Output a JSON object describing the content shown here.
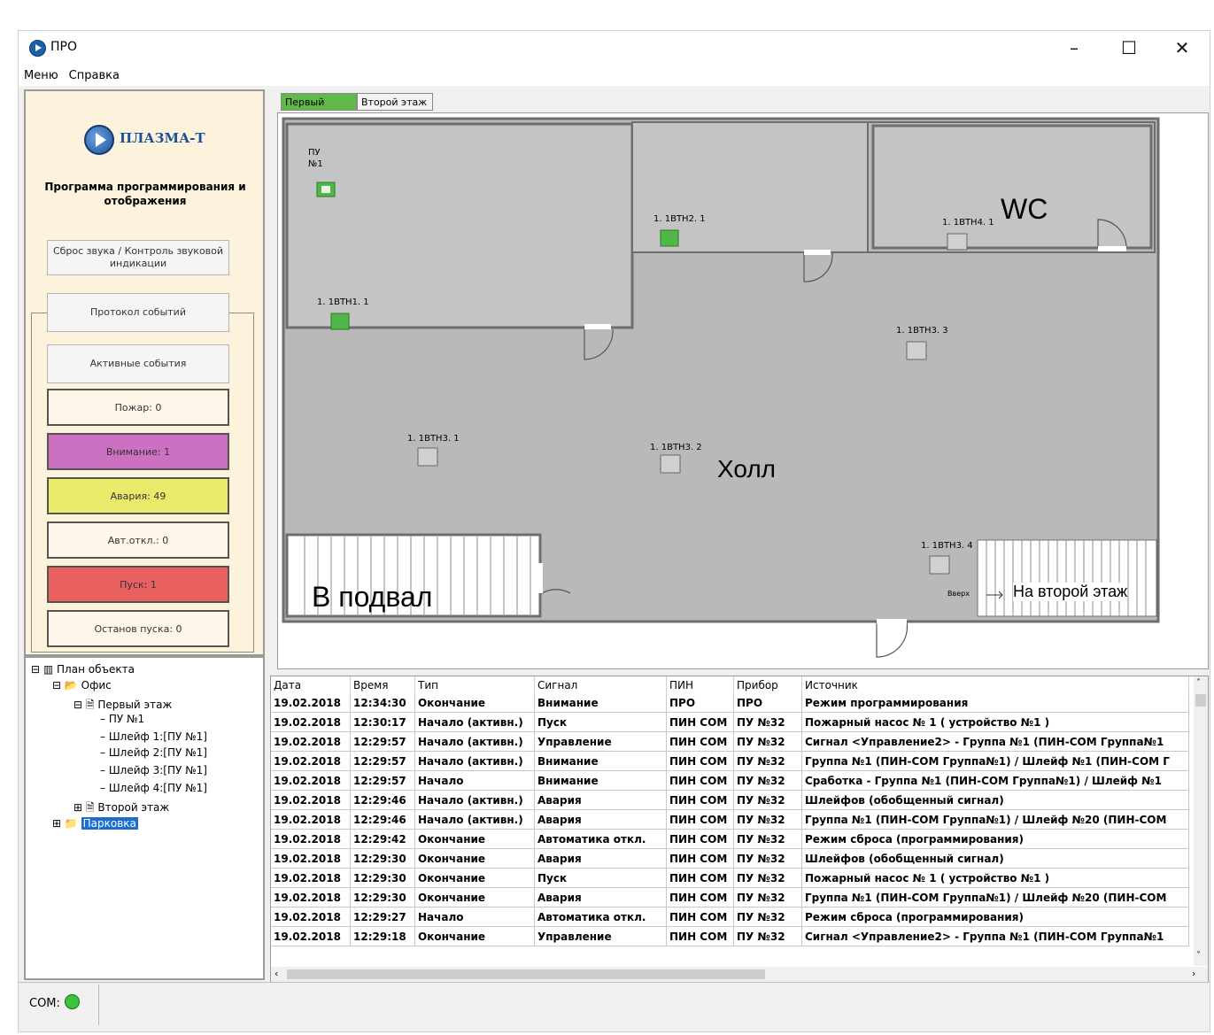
{
  "window": {
    "title": "ПРО",
    "minimize": "–",
    "maximize": "☐",
    "close": "✕"
  },
  "menu": {
    "items": [
      "Меню",
      "Справка"
    ]
  },
  "left": {
    "logo": "ПЛАЗМА-Т",
    "subtitle": "Программа программирования и отображения",
    "sound_reset": "Сброс звука / Контроль звуковой индикации",
    "protocol": "Протокол событий",
    "active_events": "Активные события",
    "fire": "Пожар: 0",
    "attention": "Внимание: 1",
    "fault": "Авария: 49",
    "auto_off": "Авт.откл.: 0",
    "start": "Пуск: 1",
    "stop_start": "Останов пуска: 0",
    "colors": {
      "fire": "#fdf6e9",
      "attention": "#cc70c2",
      "fault": "#eaea6a",
      "auto_off": "#fdf6e9",
      "start": "#e86060",
      "stop_start": "#fdf6e9"
    }
  },
  "tree": {
    "root": "План объекта",
    "office": "Офис",
    "floor1": "Первый этаж",
    "pu": "ПУ №1",
    "loop1": "Шлейф 1:[ПУ №1]",
    "loop2": "Шлейф 2:[ПУ №1]",
    "loop3": "Шлейф 3:[ПУ №1]",
    "loop4": "Шлейф 4:[ПУ №1]",
    "floor2": "Второй этаж",
    "parking": "Парковка"
  },
  "tabs": [
    "Первый этаж",
    "Второй этаж"
  ],
  "plan": {
    "pu_label": "ПУ\n№1",
    "devices": [
      "1. 1ВТН2. 1",
      "1. 1ВТН4. 1",
      "1. 1ВТН1. 1",
      "1. 1ВТН3. 3",
      "1. 1ВТН3. 1",
      "1. 1ВТН3. 2",
      "1. 1ВТН3. 4"
    ],
    "rooms": {
      "wc": "WC",
      "hall": "Холл",
      "basement": "В подвал",
      "second_floor": "На второй этаж",
      "up": "Вверх"
    }
  },
  "events": {
    "columns": [
      "Дата",
      "Время",
      "Тип",
      "Сигнал",
      "ПИН",
      "Прибор",
      "Источник"
    ],
    "rows": [
      [
        "19.02.2018",
        "12:34:30",
        "Окончание",
        "Внимание",
        "ПРО",
        "ПРО",
        "Режим программирования"
      ],
      [
        "19.02.2018",
        "12:30:17",
        "Начало (активн.)",
        "Пуск",
        "ПИН СОМ",
        "ПУ №32",
        "Пожарный насос  № 1  ( устройство №1 )"
      ],
      [
        "19.02.2018",
        "12:29:57",
        "Начало (активн.)",
        "Управление",
        "ПИН СОМ",
        "ПУ №32",
        "Сигнал <Управление2>  - Группа №1 (ПИН-СОМ Группа№1"
      ],
      [
        "19.02.2018",
        "12:29:57",
        "Начало (активн.)",
        "Внимание",
        "ПИН СОМ",
        "ПУ №32",
        "Группа №1 (ПИН-СОМ Группа№1) / Шлейф №1 (ПИН-СОМ Г"
      ],
      [
        "19.02.2018",
        "12:29:57",
        "Начало",
        "Внимание",
        "ПИН СОМ",
        "ПУ №32",
        "Сработка - Группа №1 (ПИН-СОМ Группа№1) / Шлейф №1"
      ],
      [
        "19.02.2018",
        "12:29:46",
        "Начало (активн.)",
        "Авария",
        "ПИН СОМ",
        "ПУ №32",
        "Шлейфов (обобщенный сигнал)"
      ],
      [
        "19.02.2018",
        "12:29:46",
        "Начало (активн.)",
        "Авария",
        "ПИН СОМ",
        "ПУ №32",
        "Группа №1 (ПИН-СОМ Группа№1) / Шлейф №20 (ПИН-СОМ"
      ],
      [
        "19.02.2018",
        "12:29:42",
        "Окончание",
        "Автоматика откл.",
        "ПИН СОМ",
        "ПУ №32",
        "Режим сброса (программирования)"
      ],
      [
        "19.02.2018",
        "12:29:30",
        "Окончание",
        "Авария",
        "ПИН СОМ",
        "ПУ №32",
        "Шлейфов (обобщенный сигнал)"
      ],
      [
        "19.02.2018",
        "12:29:30",
        "Окончание",
        "Пуск",
        "ПИН СОМ",
        "ПУ №32",
        "Пожарный насос  № 1  ( устройство №1 )"
      ],
      [
        "19.02.2018",
        "12:29:30",
        "Окончание",
        "Авария",
        "ПИН СОМ",
        "ПУ №32",
        "Группа №1 (ПИН-СОМ Группа№1) / Шлейф №20 (ПИН-СОМ"
      ],
      [
        "19.02.2018",
        "12:29:27",
        "Начало",
        "Автоматика откл.",
        "ПИН СОМ",
        "ПУ №32",
        "Режим сброса (программирования)"
      ],
      [
        "19.02.2018",
        "12:29:18",
        "Окончание",
        "Управление",
        "ПИН СОМ",
        "ПУ №32",
        "Сигнал <Управление2>  - Группа №1 (ПИН-СОМ Группа№1"
      ]
    ]
  },
  "status": {
    "com_label": "COM:",
    "com_color": "#3bc43b"
  }
}
